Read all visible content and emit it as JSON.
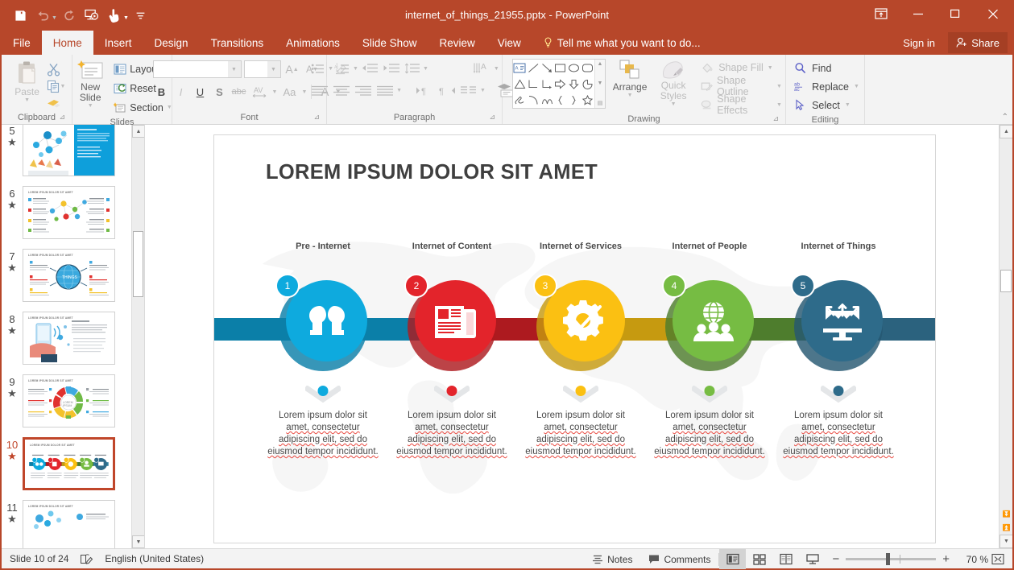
{
  "window": {
    "title": "internet_of_things_21955.pptx - PowerPoint",
    "accent": "#b7472a",
    "controls": {
      "ribbon_display": "ribbon-display-options-icon",
      "minimize": "minimize-icon",
      "restore": "restore-icon",
      "close": "close-icon"
    }
  },
  "quick_access": [
    {
      "name": "save",
      "icon": "save-icon",
      "enabled": true
    },
    {
      "name": "undo",
      "icon": "undo-icon",
      "enabled": false
    },
    {
      "name": "redo",
      "icon": "redo-icon",
      "enabled": false
    },
    {
      "name": "start-from-beginning",
      "icon": "slideshow-icon",
      "enabled": true
    },
    {
      "name": "touch-mouse-mode",
      "icon": "touch-mode-icon",
      "enabled": true
    },
    {
      "name": "customize-quick-access-toolbar",
      "icon": "chevron-down-icon",
      "enabled": true
    }
  ],
  "tabs": [
    {
      "label": "File",
      "active": false
    },
    {
      "label": "Home",
      "active": true
    },
    {
      "label": "Insert",
      "active": false
    },
    {
      "label": "Design",
      "active": false
    },
    {
      "label": "Transitions",
      "active": false
    },
    {
      "label": "Animations",
      "active": false
    },
    {
      "label": "Slide Show",
      "active": false
    },
    {
      "label": "Review",
      "active": false
    },
    {
      "label": "View",
      "active": false
    }
  ],
  "tell_me": "Tell me what you want to do...",
  "sign_in": "Sign in",
  "share": "Share",
  "ribbon": {
    "clipboard": {
      "label": "Clipboard",
      "paste": "Paste",
      "cut": "Cut",
      "copy": "Copy",
      "format_painter": "Format Painter"
    },
    "slides": {
      "label": "Slides",
      "new_slide": "New Slide",
      "layout": "Layout",
      "reset": "Reset",
      "section": "Section"
    },
    "font": {
      "label": "Font",
      "font_name": "",
      "font_name_placeholder": "",
      "font_size": "",
      "font_size_placeholder": "",
      "increase_size": "A",
      "decrease_size": "A",
      "clear_formatting": "Clear All Formatting",
      "bold": "B",
      "italic": "I",
      "underline": "U",
      "shadow": "S",
      "strikethrough": "abc",
      "character_spacing": "AV",
      "change_case": "Aa",
      "font_color": "A"
    },
    "paragraph": {
      "label": "Paragraph"
    },
    "drawing": {
      "label": "Drawing",
      "arrange": "Arrange",
      "quick_styles": "Quick Styles",
      "shape_fill": "Shape Fill",
      "shape_outline": "Shape Outline",
      "shape_effects": "Shape Effects"
    },
    "editing": {
      "label": "Editing",
      "find": "Find",
      "replace": "Replace",
      "select": "Select"
    }
  },
  "thumbnails": [
    {
      "number": "5",
      "title": "",
      "selected": false,
      "kind": "cloud-network"
    },
    {
      "number": "6",
      "title": "LOREM IPSUM DOLOR SIT AMET",
      "selected": false,
      "kind": "network-nodes"
    },
    {
      "number": "7",
      "title": "LOREM IPSUM DOLOR SIT AMET",
      "selected": false,
      "kind": "globe-hub"
    },
    {
      "number": "8",
      "title": "LOREM IPSUM DOLOR SIT AMET",
      "selected": false,
      "kind": "phone-hand"
    },
    {
      "number": "9",
      "title": "LOREM IPSUM DOLOR SIT AMET",
      "selected": false,
      "kind": "gear-wheel"
    },
    {
      "number": "10",
      "title": "LOREM IPSUM DOLOR SIT AMET",
      "selected": true,
      "kind": "timeline"
    },
    {
      "number": "11",
      "title": "LOREM IPSUM DOLOR SIT AMET",
      "selected": false,
      "kind": "dots-network"
    }
  ],
  "slide": {
    "title": "LOREM IPSUM DOLOR SIT AMET",
    "body_text_line1": "Lorem ipsum dolor sit",
    "body_text_line2": "amet, consectetur",
    "body_text_line3": "adipiscing elit, sed do",
    "body_text_line4": "eiusmod tempor incididunt.",
    "steps": [
      {
        "number": "1",
        "label": "Pre - Internet",
        "color": "#0eaade",
        "dark": "#0b7fa8",
        "icon": "two-heads-icon"
      },
      {
        "number": "2",
        "label": "Internet of Content",
        "color": "#e3242b",
        "dark": "#ad1a1f",
        "icon": "newspaper-icon"
      },
      {
        "number": "3",
        "label": "Internet of Services",
        "color": "#fbc012",
        "dark": "#c69a10",
        "icon": "gear-check-icon"
      },
      {
        "number": "4",
        "label": "Internet of People",
        "color": "#76bc43",
        "dark": "#4e7d2d",
        "icon": "globe-people-icon"
      },
      {
        "number": "5",
        "label": "Internet of Things",
        "color": "#2e6b8a",
        "dark": "#265871",
        "icon": "monitor-arrows-icon"
      }
    ]
  },
  "status_bar": {
    "slide_counter": "Slide 10 of 24",
    "spellcheck_icon": "spellcheck-icon",
    "language": "English (United States)",
    "notes": "Notes",
    "comments": "Comments",
    "views": [
      {
        "name": "normal-view",
        "active": true
      },
      {
        "name": "slide-sorter-view",
        "active": false
      },
      {
        "name": "reading-view",
        "active": false
      },
      {
        "name": "slide-show-view",
        "active": false
      }
    ],
    "zoom_out": "−",
    "zoom_in": "+",
    "zoom_level": "70 %",
    "fit_slide": "fit-slide-to-window-icon"
  }
}
